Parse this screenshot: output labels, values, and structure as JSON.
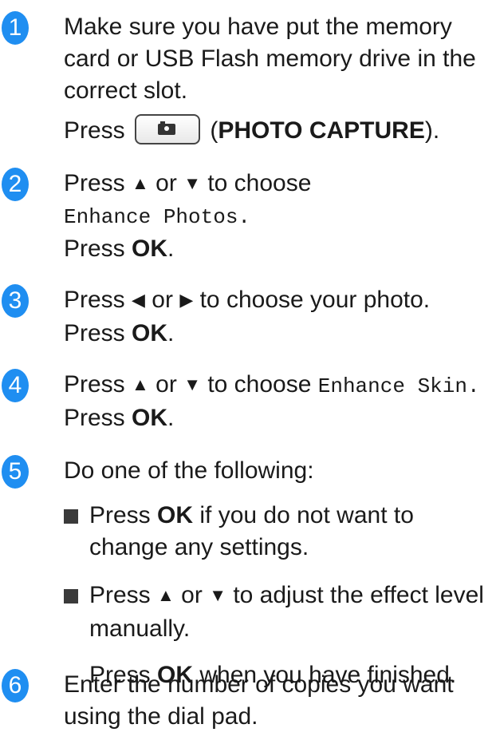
{
  "steps": [
    {
      "number": "1",
      "lines": [
        "Make sure you have put the memory",
        "card or USB Flash memory drive in the",
        "correct slot."
      ],
      "press_prefix": "Press",
      "button_label": "PHOTO CAPTURE",
      "button_icon": "camera-icon"
    },
    {
      "number": "2",
      "line1_prefix": "Press",
      "line1_or": "or",
      "line1_suffix": "to choose",
      "menu_item": "Enhance Photos.",
      "press_word": "Press",
      "ok": "OK"
    },
    {
      "number": "3",
      "line1_prefix": "Press",
      "line1_or": "or",
      "line1_suffix": "to choose your photo.",
      "press_word": "Press",
      "ok": "OK"
    },
    {
      "number": "4",
      "line1_prefix": "Press",
      "line1_or": "or",
      "line1_mid": "to choose",
      "menu_item": "Enhance Skin.",
      "press_word": "Press",
      "ok": "OK"
    },
    {
      "number": "5",
      "intro": "Do one of the following:",
      "bullets": [
        {
          "press_word": "Press",
          "ok": "OK",
          "rest1": "if you do not want to",
          "rest2": "change any settings."
        },
        {
          "press_word": "Press",
          "or": "or",
          "rest1": "to adjust the effect level",
          "rest2": "manually.",
          "followup_press": "Press",
          "followup_ok": "OK",
          "followup_rest": "when you have finished."
        }
      ]
    },
    {
      "number": "6",
      "lines": [
        "Enter the number of copies you want",
        "using the dial pad."
      ]
    }
  ],
  "colors": {
    "badge": "#1f8ef1",
    "text": "#1a1a1a"
  }
}
